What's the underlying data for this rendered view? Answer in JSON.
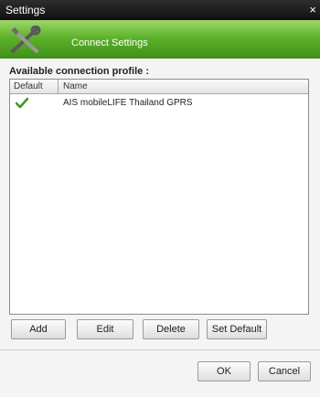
{
  "window": {
    "title": "Settings",
    "close_glyph": "×"
  },
  "banner": {
    "heading": "Connect Settings",
    "icon": "tools-icon"
  },
  "profiles": {
    "label": "Available connection profile :",
    "columns": [
      "Default",
      "Name"
    ],
    "rows": [
      {
        "is_default": true,
        "name": "AIS mobileLIFE Thailand GPRS"
      }
    ]
  },
  "actions": {
    "add": "Add",
    "edit": "Edit",
    "delete": "Delete",
    "set_default": "Set Default"
  },
  "dialog_buttons": {
    "ok": "OK",
    "cancel": "Cancel"
  },
  "colors": {
    "banner_green": "#5db22b",
    "check_green": "#3a9d23",
    "titlebar": "#1a1a1a"
  }
}
